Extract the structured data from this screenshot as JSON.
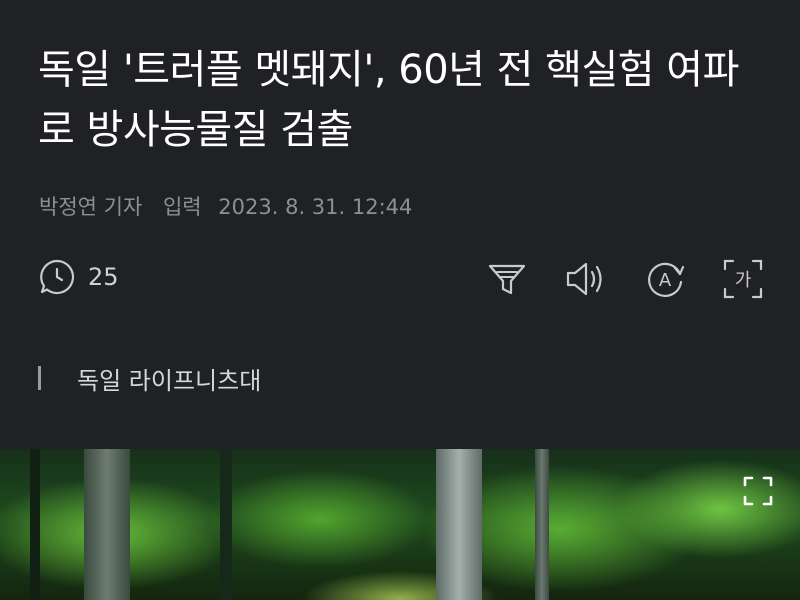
{
  "article": {
    "headline": "독일 '트러플 멧돼지', 60년 전 핵실험 여파로 방사능물질 검출",
    "byline": {
      "reporter": "박정연 기자",
      "input_label": "입력",
      "timestamp": "2023. 8. 31. 12:44"
    },
    "subtitle": "독일 라이프니츠대"
  },
  "toolbar": {
    "comment_count": "25",
    "icons": [
      "comment-icon",
      "filter-icon",
      "speaker-icon",
      "translate-icon",
      "font-size-icon"
    ],
    "font_button_glyph": "가",
    "translate_glyph": "A"
  },
  "photo": {
    "icons": [
      "expand-icon"
    ]
  },
  "colors": {
    "background": "#202124",
    "headline": "#ffffff",
    "meta": "#8e8f93",
    "icon": "#c9cacd"
  }
}
